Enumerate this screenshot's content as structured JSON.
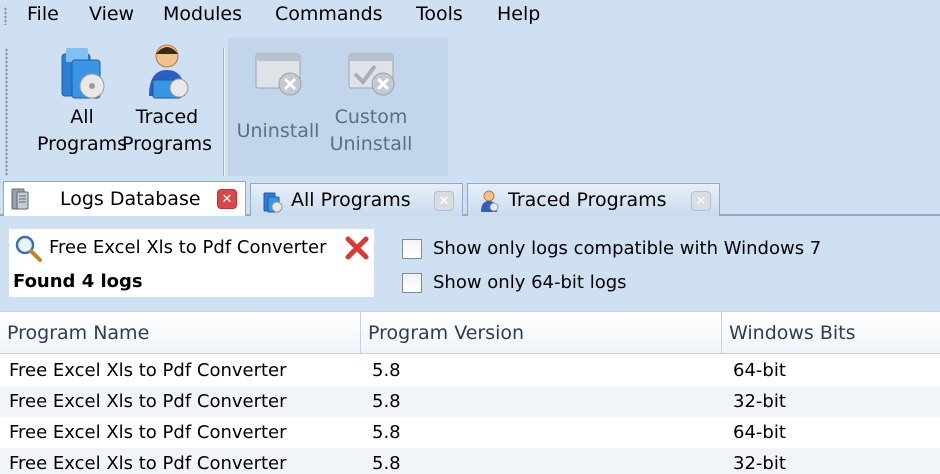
{
  "menu": {
    "items": [
      "File",
      "View",
      "Modules",
      "Commands",
      "Tools",
      "Help"
    ]
  },
  "toolbar": {
    "all_programs": {
      "line1": "All",
      "line2": "Programs",
      "icon": "all-programs-icon"
    },
    "traced_programs": {
      "line1": "Traced",
      "line2": "Programs",
      "icon": "traced-programs-icon"
    },
    "uninstall": {
      "label": "Uninstall",
      "icon": "uninstall-icon"
    },
    "custom_uninstall": {
      "line1": "Custom",
      "line2": "Uninstall",
      "icon": "custom-uninstall-icon"
    }
  },
  "tabs": [
    {
      "label": "Logs Database",
      "active": true,
      "icon": "database-icon"
    },
    {
      "label": "All Programs",
      "active": false,
      "icon": "all-programs-icon"
    },
    {
      "label": "Traced Programs",
      "active": false,
      "icon": "traced-programs-icon"
    }
  ],
  "search": {
    "value": "Free Excel Xls to Pdf Converter",
    "result": "Found 4 logs"
  },
  "filters": {
    "win7": {
      "label": "Show only logs compatible with Windows 7",
      "checked": false
    },
    "bit64": {
      "label": "Show only 64-bit logs",
      "checked": false
    }
  },
  "table": {
    "columns": [
      "Program Name",
      "Program Version",
      "Windows Bits"
    ],
    "rows": [
      [
        "Free Excel Xls to Pdf Converter",
        "5.8",
        "64-bit"
      ],
      [
        "Free Excel Xls to Pdf Converter",
        "5.8",
        "32-bit"
      ],
      [
        "Free Excel Xls to Pdf Converter",
        "5.8",
        "64-bit"
      ],
      [
        "Free Excel Xls to Pdf Converter",
        "5.8",
        "32-bit"
      ]
    ]
  },
  "colors": {
    "background": "#cfe0f3",
    "accent": "#8ea9cb",
    "close_active": "#d84848"
  }
}
